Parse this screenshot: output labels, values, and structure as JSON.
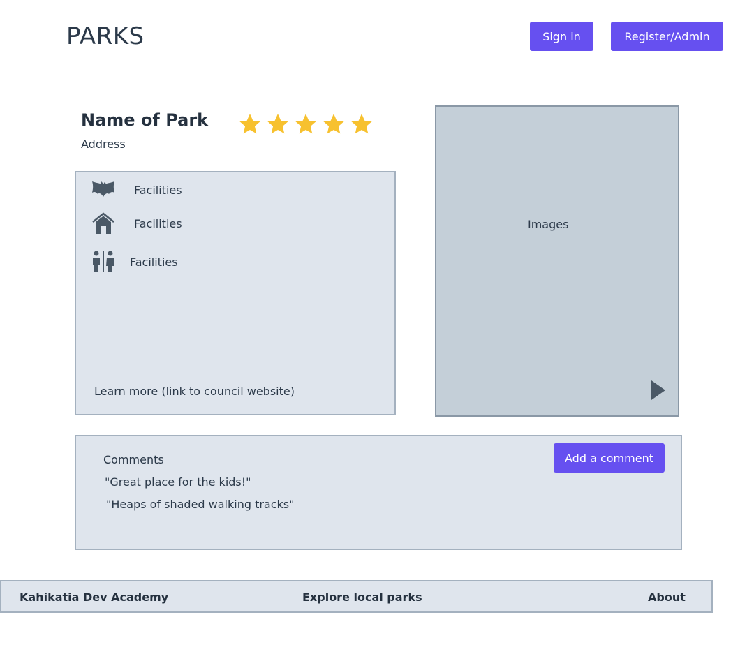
{
  "header": {
    "logo": "PARKS",
    "sign_in_label": "Sign in",
    "register_label": "Register/Admin"
  },
  "park": {
    "name": "Name of Park",
    "address": "Address",
    "rating": 5,
    "max_rating": 5,
    "star_color": "#f7c12f"
  },
  "facilities": {
    "items": [
      {
        "icon": "bat-icon",
        "label": "Facilities"
      },
      {
        "icon": "house-icon",
        "label": "Facilities"
      },
      {
        "icon": "toilet-icon",
        "label": "Facilities"
      }
    ],
    "learn_more": "Learn more (link to council website)"
  },
  "images": {
    "label": "Images",
    "next_icon": "play-icon"
  },
  "comments": {
    "title": "Comments",
    "add_label": "Add a comment",
    "items": [
      "\"Great place for the kids!\"",
      "\"Heaps of shaded walking tracks\""
    ]
  },
  "footer": {
    "left": "Kahikatia Dev Academy",
    "center": "Explore local parks",
    "right": "About"
  },
  "colors": {
    "accent": "#6650f0",
    "panel": "#dfe5ed",
    "image_panel": "#c4cfd8",
    "text": "#2c3a4a"
  }
}
